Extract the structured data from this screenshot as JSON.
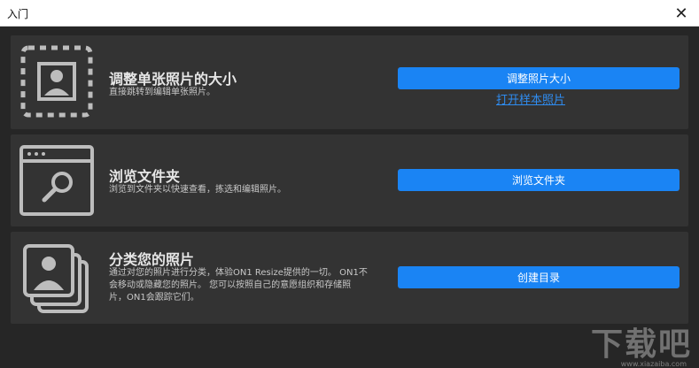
{
  "window": {
    "title": "入门",
    "close_label": "✕"
  },
  "cards": [
    {
      "heading": "调整单张照片的大小",
      "desc": "直接跳转到编辑单张照片。",
      "button": "调整照片大小",
      "link": "打开样本照片"
    },
    {
      "heading": "浏览文件夹",
      "desc": "浏览到文件夹以快速查看，拣选和编辑照片。",
      "button": "浏览文件夹"
    },
    {
      "heading": "分类您的照片",
      "desc_lines": [
        "通过对您的照片进行分类，体验ON1 Resize提供的一切。 ON1不",
        "会移动或隐藏您的照片。 您可以按照自己的意愿组织和存储照",
        "片，ON1会跟踪它们。"
      ],
      "button": "创建目录"
    }
  ],
  "watermark": {
    "text": "下载吧",
    "url": "www.xiazaiba.com"
  },
  "colors": {
    "accent": "#1a84f4",
    "card_bg": "#333333",
    "window_bg": "#262626"
  }
}
